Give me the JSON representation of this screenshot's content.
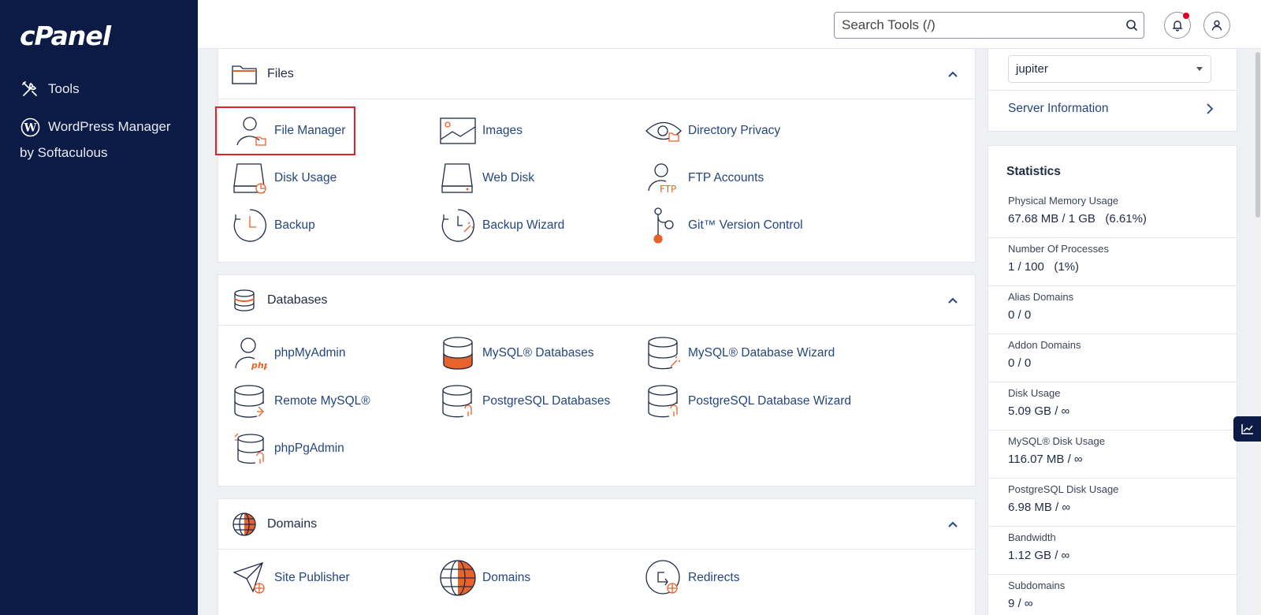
{
  "sidebar": {
    "logo": "cPanel",
    "items": [
      {
        "label": "Tools",
        "icon": "tools-icon"
      },
      {
        "label": "WordPress Manager",
        "sub": "by Softaculous",
        "icon": "wordpress-icon"
      }
    ]
  },
  "header": {
    "search_placeholder": "Search Tools (/)"
  },
  "sections": {
    "files": {
      "title": "Files",
      "tools": [
        "File Manager",
        "Images",
        "Directory Privacy",
        "Disk Usage",
        "Web Disk",
        "FTP Accounts",
        "Backup",
        "Backup Wizard",
        "Git™ Version Control"
      ]
    },
    "databases": {
      "title": "Databases",
      "tools": [
        "phpMyAdmin",
        "MySQL® Databases",
        "MySQL® Database Wizard",
        "Remote MySQL®",
        "PostgreSQL Databases",
        "PostgreSQL Database Wizard",
        "phpPgAdmin"
      ]
    },
    "domains": {
      "title": "Domains",
      "tools": [
        "Site Publisher",
        "Domains",
        "Redirects"
      ]
    }
  },
  "right_panel": {
    "theme": "jupiter",
    "server_info": "Server Information",
    "stats_title": "Statistics",
    "stats": [
      {
        "label": "Physical Memory Usage",
        "value": "67.68 MB / 1 GB   (6.61%)"
      },
      {
        "label": "Number Of Processes",
        "value": "1 / 100   (1%)"
      },
      {
        "label": "Alias Domains",
        "value": "0 / 0"
      },
      {
        "label": "Addon Domains",
        "value": "0 / 0"
      },
      {
        "label": "Disk Usage",
        "value": "5.09 GB / ∞"
      },
      {
        "label": "MySQL® Disk Usage",
        "value": "116.07 MB / ∞"
      },
      {
        "label": "PostgreSQL Disk Usage",
        "value": "6.98 MB / ∞"
      },
      {
        "label": "Bandwidth",
        "value": "1.12 GB / ∞"
      },
      {
        "label": "Subdomains",
        "value": "9 / ∞"
      }
    ]
  },
  "colors": {
    "sidebar": "#0b1b46",
    "accent": "#e8622a",
    "link": "#23467f"
  }
}
